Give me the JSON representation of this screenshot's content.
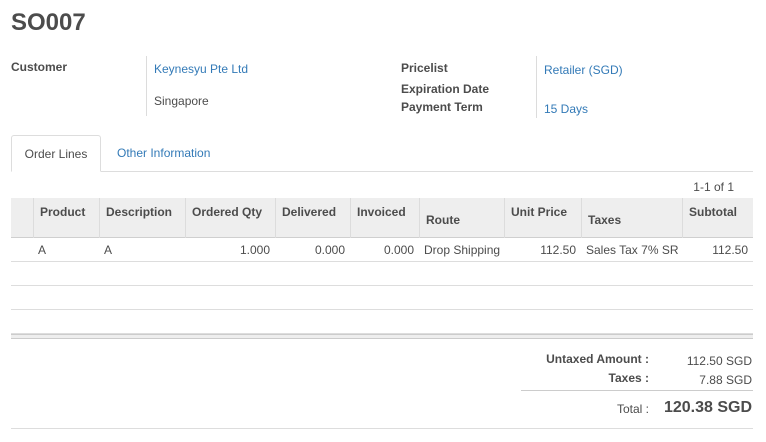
{
  "order": {
    "name": "SO007"
  },
  "fields": {
    "customer_label": "Customer",
    "customer_name": "Keynesyu Pte Ltd",
    "customer_address": "Singapore",
    "pricelist_label": "Pricelist",
    "pricelist_value": "Retailer (SGD)",
    "expiration_label": "Expiration Date",
    "expiration_value": "",
    "payment_term_label": "Payment Term",
    "payment_term_value": "15 Days"
  },
  "tabs": [
    {
      "label": "Order Lines",
      "active": true
    },
    {
      "label": "Other Information",
      "active": false
    }
  ],
  "pager": "1-1 of 1",
  "table": {
    "columns": [
      "Product",
      "Description",
      "Ordered Qty",
      "Delivered",
      "Invoiced",
      "Route",
      "Unit Price",
      "Taxes",
      "Subtotal"
    ],
    "rows": [
      {
        "product": "A",
        "description": "A",
        "ordered_qty": "1.000",
        "delivered": "0.000",
        "invoiced": "0.000",
        "route": "Drop Shipping",
        "unit_price": "112.50",
        "taxes": "Sales Tax 7% SR",
        "subtotal": "112.50"
      }
    ]
  },
  "totals": {
    "untaxed_label": "Untaxed Amount :",
    "untaxed_value": "112.50 SGD",
    "taxes_label": "Taxes :",
    "taxes_value": "7.88 SGD",
    "total_label": "Total :",
    "total_value": "120.38 SGD"
  }
}
